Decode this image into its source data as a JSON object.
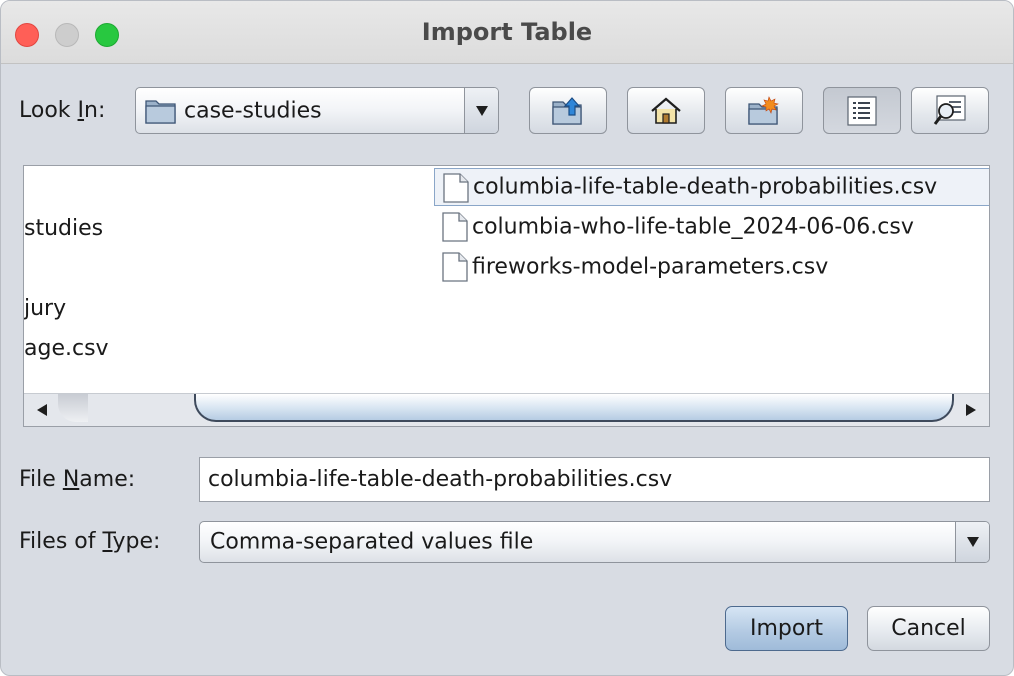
{
  "window": {
    "title": "Import Table"
  },
  "lookin": {
    "label_prefix": "Look ",
    "label_mnemonic": "I",
    "label_suffix": "n:",
    "value": "case-studies",
    "icon": "folder-icon"
  },
  "toolbar": {
    "buttons": [
      {
        "name": "up-one-level",
        "icon": "folder-up-icon"
      },
      {
        "name": "home",
        "icon": "home-icon"
      },
      {
        "name": "new-folder",
        "icon": "new-folder-icon"
      },
      {
        "name": "list-view",
        "icon": "list-view-icon",
        "active": true
      },
      {
        "name": "details-view",
        "icon": "details-view-icon",
        "active": false
      }
    ]
  },
  "file_list": {
    "left_column": [
      "studies",
      "jury",
      "age.csv"
    ],
    "right_column": [
      {
        "name": "columbia-life-table-death-probabilities.csv",
        "selected": true,
        "icon": "file-icon"
      },
      {
        "name": "columbia-who-life-table_2024-06-06.csv",
        "selected": false,
        "icon": "file-icon"
      },
      {
        "name": "fireworks-model-parameters.csv",
        "selected": false,
        "icon": "file-icon"
      }
    ]
  },
  "file_name": {
    "label_prefix": "File ",
    "label_mnemonic": "N",
    "label_suffix": "ame:",
    "value": "columbia-life-table-death-probabilities.csv"
  },
  "file_type": {
    "label_prefix": "Files of ",
    "label_mnemonic": "T",
    "label_suffix": "ype:",
    "value": "Comma-separated values file"
  },
  "actions": {
    "import_label": "Import",
    "cancel_label": "Cancel"
  },
  "colors": {
    "window_bg": "#d8dce3",
    "selection_border": "#8aa6c8",
    "default_button": "#b2c9e2"
  }
}
